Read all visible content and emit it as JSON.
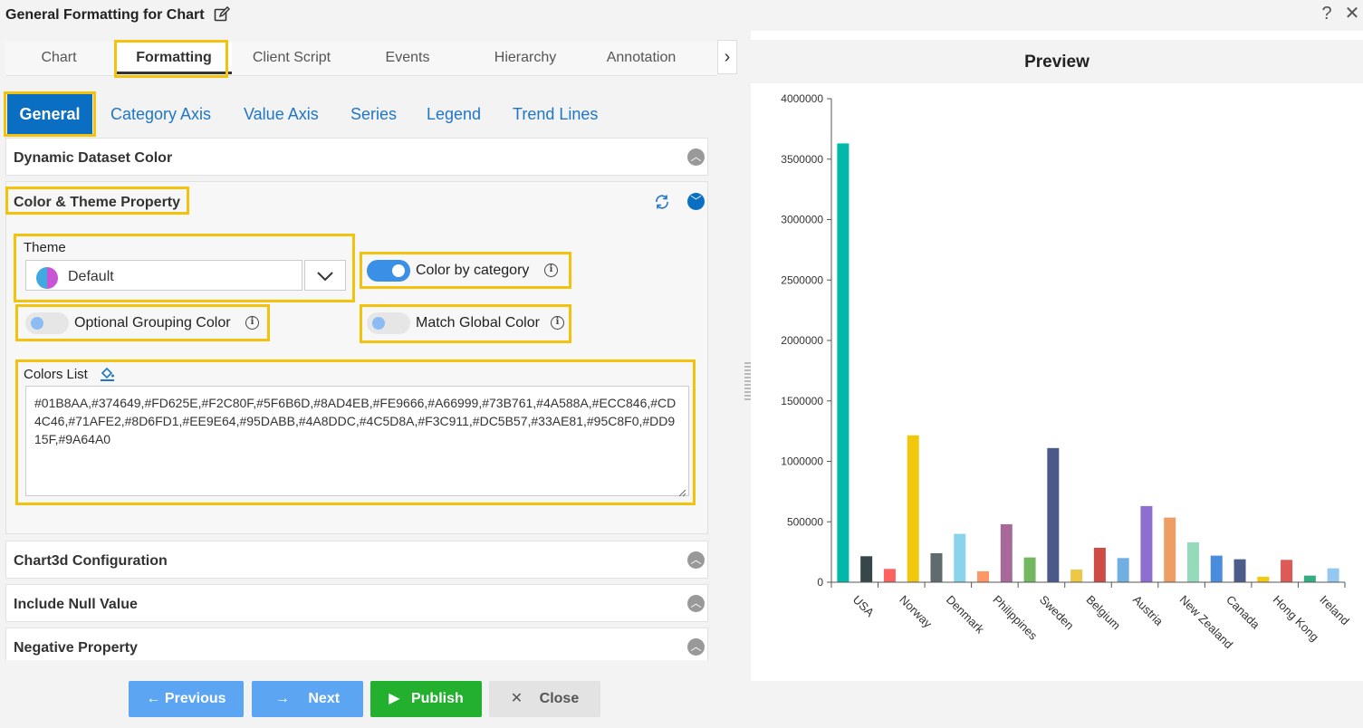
{
  "window": {
    "title": "General Formatting for Chart",
    "help_glyph": "?",
    "close_glyph": "✕"
  },
  "top_tabs": [
    {
      "label": "Chart"
    },
    {
      "label": "Formatting",
      "active": true
    },
    {
      "label": "Client Script"
    },
    {
      "label": "Events"
    },
    {
      "label": "Hierarchy"
    },
    {
      "label": "Annotation"
    }
  ],
  "sub_tabs": [
    {
      "label": "General",
      "active": true
    },
    {
      "label": "Category Axis"
    },
    {
      "label": "Value Axis"
    },
    {
      "label": "Series"
    },
    {
      "label": "Legend"
    },
    {
      "label": "Trend Lines"
    }
  ],
  "panels": {
    "dynamic_dataset_color": "Dynamic Dataset Color",
    "color_theme_property": "Color & Theme Property",
    "chart3d_configuration": "Chart3d Configuration",
    "include_null_value": "Include Null Value",
    "negative_property": "Negative Property"
  },
  "theme": {
    "label": "Theme",
    "value": "Default"
  },
  "toggles": {
    "color_by_category": {
      "label": "Color by category",
      "on": true
    },
    "optional_grouping_color": {
      "label": "Optional Grouping Color",
      "on": false
    },
    "match_global_color": {
      "label": "Match Global Color",
      "on": false
    }
  },
  "colors_list": {
    "label": "Colors List",
    "value": "#01B8AA,#374649,#FD625E,#F2C80F,#5F6B6D,#8AD4EB,#FE9666,#A66999,#73B761,#4A588A,#ECC846,#CD4C46,#71AFE2,#8D6FD1,#EE9E64,#95DABB,#4A8DDC,#4C5D8A,#F3C911,#DC5B57,#33AE81,#95C8F0,#DD915F,#9A64A0"
  },
  "footer": {
    "previous": "Previous",
    "next": "Next",
    "publish": "Publish",
    "close": "Close"
  },
  "preview": {
    "title": "Preview"
  },
  "chart_data": {
    "type": "bar",
    "title": "",
    "xlabel": "",
    "ylabel": "",
    "ylim": [
      0,
      4000000
    ],
    "yticks": [
      0,
      500000,
      1000000,
      1500000,
      2000000,
      2500000,
      3000000,
      3500000,
      4000000
    ],
    "tick_labels": [
      "USA",
      "Norway",
      "Denmark",
      "Philippines",
      "Sweden",
      "Belgium",
      "Austria",
      "New Zealand",
      "Canada",
      "Hong Kong",
      "Ireland"
    ],
    "bars": [
      {
        "value": 3630000,
        "color": "#01B8AA"
      },
      {
        "value": 215000,
        "color": "#374649"
      },
      {
        "value": 110000,
        "color": "#FD625E"
      },
      {
        "value": 1215000,
        "color": "#F2C80F"
      },
      {
        "value": 240000,
        "color": "#5F6B6D"
      },
      {
        "value": 400000,
        "color": "#8AD4EB"
      },
      {
        "value": 90000,
        "color": "#FE9666"
      },
      {
        "value": 480000,
        "color": "#A66999"
      },
      {
        "value": 205000,
        "color": "#73B761"
      },
      {
        "value": 1110000,
        "color": "#4A588A"
      },
      {
        "value": 105000,
        "color": "#ECC846"
      },
      {
        "value": 285000,
        "color": "#CD4C46"
      },
      {
        "value": 200000,
        "color": "#71AFE2"
      },
      {
        "value": 630000,
        "color": "#8D6FD1"
      },
      {
        "value": 535000,
        "color": "#EE9E64"
      },
      {
        "value": 330000,
        "color": "#95DABB"
      },
      {
        "value": 220000,
        "color": "#4A8DDC"
      },
      {
        "value": 190000,
        "color": "#4C5D8A"
      },
      {
        "value": 45000,
        "color": "#F3C911"
      },
      {
        "value": 185000,
        "color": "#DC5B57"
      },
      {
        "value": 55000,
        "color": "#33AE81"
      },
      {
        "value": 115000,
        "color": "#95C8F0"
      }
    ],
    "grid": false,
    "legend": "none"
  }
}
